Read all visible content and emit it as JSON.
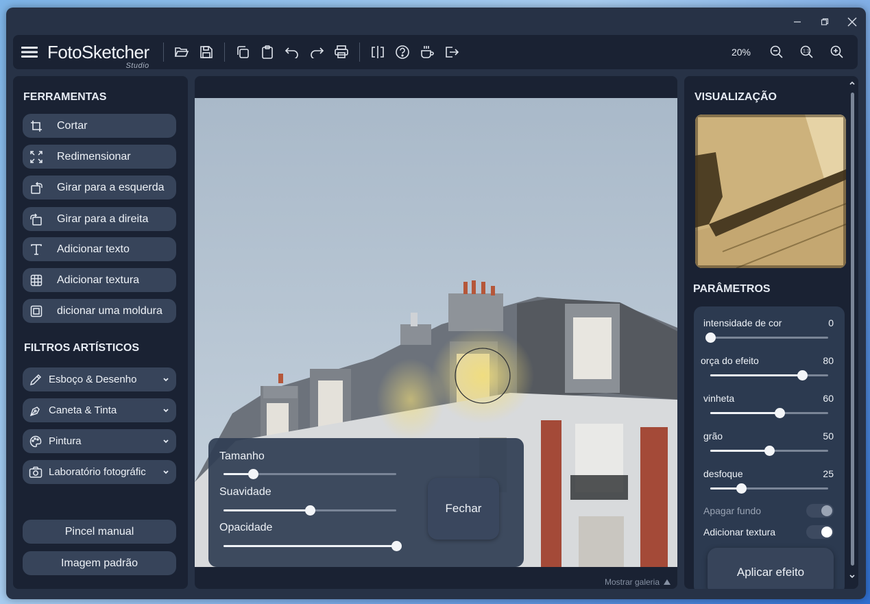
{
  "app": {
    "logo_text": "FotoSketcher",
    "logo_sub": "Studio"
  },
  "toolbar": {
    "icons": [
      "menu-icon",
      "folder-open-icon",
      "save-icon",
      "copy-icon",
      "paste-icon",
      "undo-icon",
      "redo-icon",
      "print-icon",
      "compare-icon",
      "help-icon",
      "coffee-icon",
      "exit-icon"
    ],
    "zoom": "20%"
  },
  "tools": {
    "title": "FERRAMENTAS",
    "items": [
      {
        "label": "Cortar",
        "icon": "crop-icon"
      },
      {
        "label": "Redimensionar",
        "icon": "resize-icon"
      },
      {
        "label": "Girar para a esquerda",
        "icon": "rotate-left-icon"
      },
      {
        "label": "Girar para a direita",
        "icon": "rotate-right-icon"
      },
      {
        "label": "Adicionar texto",
        "icon": "text-icon"
      },
      {
        "label": "Adicionar textura",
        "icon": "grid-icon"
      },
      {
        "label": "dicionar uma moldura",
        "icon": "frame-icon"
      }
    ]
  },
  "filters": {
    "title": "FILTROS ARTÍSTICOS",
    "items": [
      {
        "label": "Esboço & Desenho",
        "icon": "pencil-icon"
      },
      {
        "label": "Caneta & Tinta",
        "icon": "pen-icon"
      },
      {
        "label": "Pintura",
        "icon": "palette-icon"
      },
      {
        "label": "Laboratório fotográfic",
        "icon": "camera-icon"
      }
    ]
  },
  "bottom_buttons": {
    "manual_brush": "Pincel manual",
    "default_image": "Imagem padrão"
  },
  "brush": {
    "size_label": "Tamanho",
    "size_value": 0.17,
    "smooth_label": "Suavidade",
    "smooth_value": 0.5,
    "opacity_label": "Opacidade",
    "opacity_value": 1.0,
    "close": "Fechar"
  },
  "gallery": {
    "label": "Mostrar galeria"
  },
  "preview": {
    "title": "VISUALIZAÇÃO"
  },
  "params": {
    "title": "PARÂMETROS",
    "items": [
      {
        "label": "intensidade de cor",
        "value": "0",
        "level": 0.0
      },
      {
        "label": "orça do efeito",
        "value": "80",
        "level": 0.78
      },
      {
        "label": "vinheta",
        "value": "60",
        "level": 0.59
      },
      {
        "label": "grão",
        "value": "50",
        "level": 0.5
      },
      {
        "label": "desfoque",
        "value": "25",
        "level": 0.26
      }
    ],
    "toggles": [
      {
        "label": "Apagar fundo",
        "on": false
      },
      {
        "label": "Adicionar textura",
        "on": true
      }
    ],
    "apply": "Aplicar efeito"
  }
}
